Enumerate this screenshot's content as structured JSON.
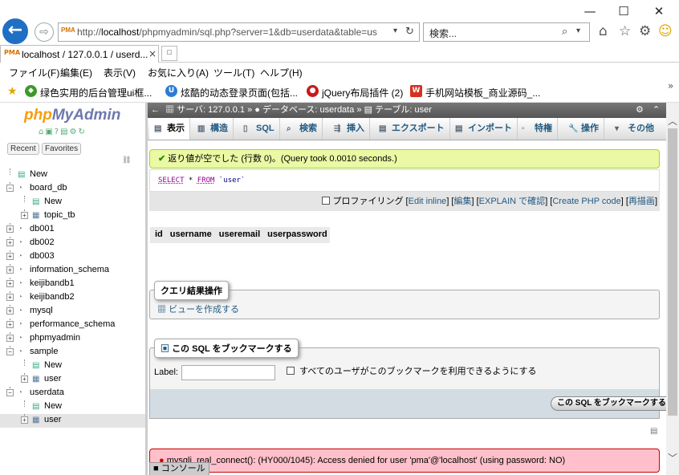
{
  "window": {
    "minimize": "—",
    "maximize": "☐",
    "close": "✕"
  },
  "address": {
    "url_prefix": "http://",
    "url_host": "localhost",
    "url_path": "/phpmyadmin/sql.php?server=1&db=userdata&table=us",
    "favicon": "PMA"
  },
  "search": {
    "placeholder": "検索..."
  },
  "tab": {
    "title": "localhost / 127.0.0.1 / userd...",
    "close": "×"
  },
  "menu": [
    "ファイル(F)",
    "編集(E)",
    "表示(V)",
    "お気に入り(A)",
    "ツール(T)",
    "ヘルプ(H)"
  ],
  "favorites": [
    {
      "label": "绿色实用的后台管理ui框...",
      "color": "#3a9a2a"
    },
    {
      "label": "炫酷的动态登录页面(包括...",
      "color": "#2c7bd6"
    },
    {
      "label": "jQuery布局插件 (2)",
      "color": "#c71a1a"
    },
    {
      "label": "手机网站模板_商业源码_...",
      "color": "#d83020"
    }
  ],
  "favorites_more": "»",
  "nav": {
    "logo_php": "php",
    "logo_my": "My",
    "logo_admin": "Admin",
    "recent": "Recent",
    "favorites": "Favorites",
    "tree": [
      {
        "label": "New",
        "level": 0,
        "type": "new"
      },
      {
        "label": "board_db",
        "level": 0,
        "type": "db",
        "open": true
      },
      {
        "label": "New",
        "level": 1,
        "type": "new"
      },
      {
        "label": "topic_tb",
        "level": 1,
        "type": "table"
      },
      {
        "label": "db001",
        "level": 0,
        "type": "db"
      },
      {
        "label": "db002",
        "level": 0,
        "type": "db"
      },
      {
        "label": "db003",
        "level": 0,
        "type": "db"
      },
      {
        "label": "information_schema",
        "level": 0,
        "type": "db"
      },
      {
        "label": "keijibandb1",
        "level": 0,
        "type": "db"
      },
      {
        "label": "keijibandb2",
        "level": 0,
        "type": "db"
      },
      {
        "label": "mysql",
        "level": 0,
        "type": "db"
      },
      {
        "label": "performance_schema",
        "level": 0,
        "type": "db"
      },
      {
        "label": "phpmyadmin",
        "level": 0,
        "type": "db"
      },
      {
        "label": "sample",
        "level": 0,
        "type": "db",
        "open": true
      },
      {
        "label": "New",
        "level": 1,
        "type": "new"
      },
      {
        "label": "user",
        "level": 1,
        "type": "table"
      },
      {
        "label": "userdata",
        "level": 0,
        "type": "db",
        "open": true
      },
      {
        "label": "New",
        "level": 1,
        "type": "new"
      },
      {
        "label": "user",
        "level": 1,
        "type": "table",
        "selected": true
      }
    ]
  },
  "breadcrumb": {
    "server": "サーバ: 127.0.0.1",
    "database": "データベース: userdata",
    "table": "テーブル: user",
    "sep": "»"
  },
  "topmenu": [
    "表示",
    "構造",
    "SQL",
    "検索",
    "挿入",
    "エクスポート",
    "インポート",
    "特権",
    "操作",
    "その他"
  ],
  "success": {
    "text": "返り値が空でした (行数 0)。(Query took 0.0010 seconds.)"
  },
  "sql": {
    "kw1": "SELECT",
    "star": " * ",
    "kw2": "FROM",
    "table": " `user`"
  },
  "sqllinks": {
    "profiling": "プロファイリング",
    "edit_inline": "Edit inline",
    "edit": "編集",
    "explain": "EXPLAIN で確認",
    "create_php": "Create PHP code",
    "refresh": "再描画"
  },
  "columns": [
    "id",
    "username",
    "useremail",
    "userpassword"
  ],
  "query_ops": {
    "legend": "クエリ結果操作",
    "create_view": "ビューを作成する"
  },
  "bookmark": {
    "legend": "この SQL をブックマークする",
    "label": "Label:",
    "share": "すべてのユーザがこのブックマークを利用できるようにする",
    "submit": "この SQL をブックマークする"
  },
  "error": {
    "text": "mysqli_real_connect(): (HY000/1045): Access denied for user 'pma'@'localhost' (using password: NO)"
  },
  "console": {
    "label": "コンソール"
  }
}
